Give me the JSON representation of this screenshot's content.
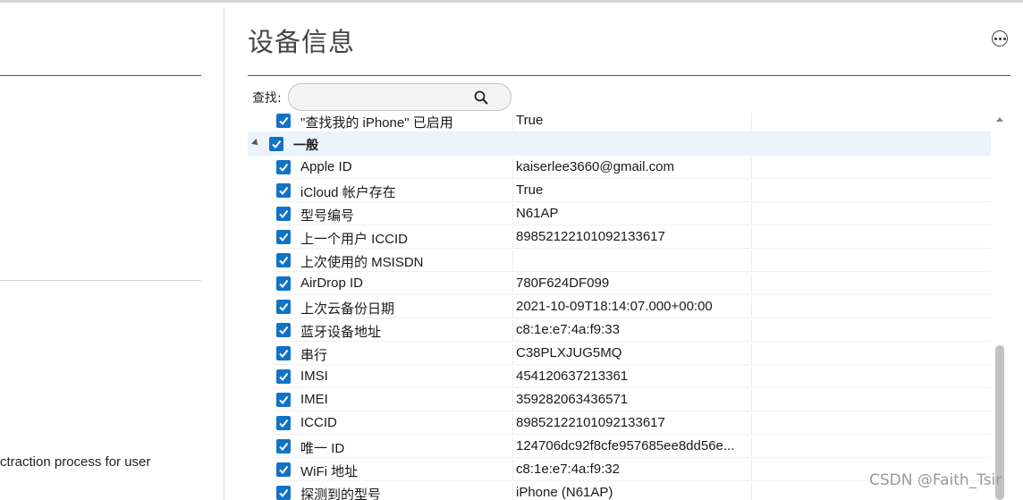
{
  "left_panel": {
    "partial_text": "ctraction process for user"
  },
  "header": {
    "title": "设备信息",
    "more_icon": "ellipsis-circle-icon"
  },
  "search": {
    "label": "查找:",
    "placeholder": "",
    "icon": "magnifier-icon"
  },
  "table": {
    "rows": [
      {
        "name": "\"查找我的 iPhone\" 已启用",
        "value": "True",
        "checked": true
      },
      {
        "name": "一般",
        "value": "",
        "checked": true,
        "group": true,
        "expanded": true
      },
      {
        "name": "Apple ID",
        "value": "kaiserlee3660@gmail.com",
        "checked": true
      },
      {
        "name": "iCloud 帐户存在",
        "value": "True",
        "checked": true
      },
      {
        "name": "型号编号",
        "value": "N61AP",
        "checked": true
      },
      {
        "name": "上一个用户 ICCID",
        "value": "89852122101092133617",
        "checked": true
      },
      {
        "name": "上次使用的 MSISDN",
        "value": "",
        "checked": true
      },
      {
        "name": "AirDrop ID",
        "value": "780F624DF099",
        "checked": true
      },
      {
        "name": "上次云备份日期",
        "value": "2021-10-09T18:14:07.000+00:00",
        "checked": true
      },
      {
        "name": "蓝牙设备地址",
        "value": "c8:1e:e7:4a:f9:33",
        "checked": true
      },
      {
        "name": "串行",
        "value": "C38PLXJUG5MQ",
        "checked": true
      },
      {
        "name": "IMSI",
        "value": "454120637213361",
        "checked": true
      },
      {
        "name": "IMEI",
        "value": "359282063436571",
        "checked": true
      },
      {
        "name": "ICCID",
        "value": "89852122101092133617",
        "checked": true
      },
      {
        "name": "唯一 ID",
        "value": "124706dc92f8cfe957685ee8dd56e...",
        "checked": true
      },
      {
        "name": "WiFi 地址",
        "value": "c8:1e:e7:4a:f9:32",
        "checked": true
      },
      {
        "name": "探测到的型号",
        "value": "iPhone (N61AP)",
        "checked": true
      }
    ]
  },
  "watermark": "CSDN @Faith_Tsir",
  "colors": {
    "checkbox": "#1173c6",
    "group_row": "#ecf3fb"
  }
}
